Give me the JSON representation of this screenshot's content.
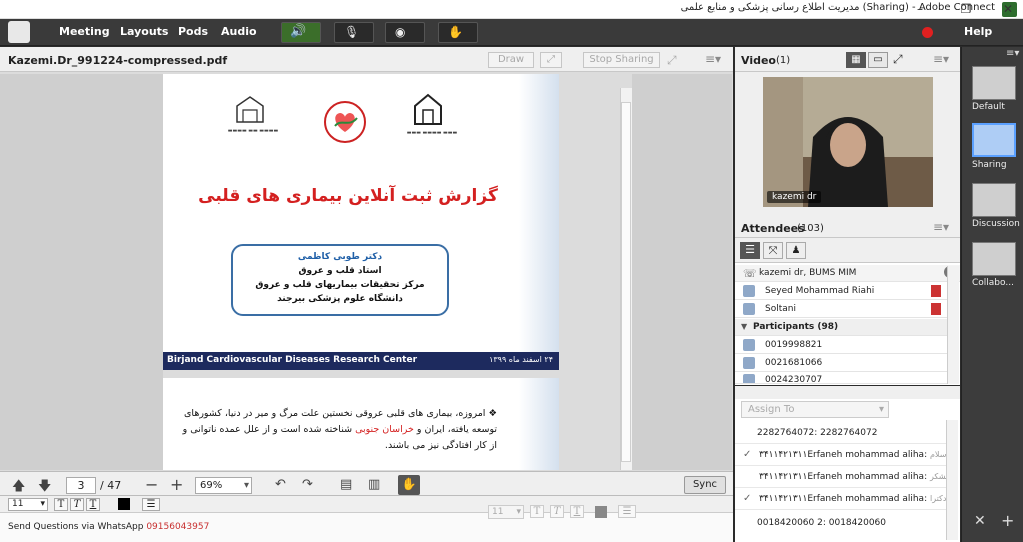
{
  "window": {
    "title": "مدیریت اطلاع رسانی پزشکی و منابع علمی (Sharing) - Adobe Connect"
  },
  "menubar": {
    "items": [
      "Meeting",
      "Layouts",
      "Pods",
      "Audio"
    ],
    "help": "Help"
  },
  "share_pod": {
    "filename": "Kazemi.Dr_991224-compressed.pdf",
    "draw_label": "Draw",
    "stop_sharing_label": "Stop Sharing",
    "page_current": "3",
    "page_total": "/ 47",
    "zoom": "69%",
    "sync_label": "Sync"
  },
  "slide": {
    "title": "گزارش ثبت آنلاین بیماری های قلبی",
    "presenter": "دکتر طوبی کاظمی",
    "line1": "استاد قلب و عروق",
    "line2": "مرکز تحقیقات بیماریهای قلب و عروق",
    "line3": "دانشگاه علوم پزشکی بیرجند",
    "banner_left": "Birjand Cardiovascular Diseases Research Center",
    "banner_right": "۲۴ اسفند ماه ۱۳۹۹",
    "body_line1": "امروزه، بیماری های قلبی عروقی نخستین علت مرگ و میر در دنیا، کشورهای",
    "body_line2a": "توسعه یافته، ایران و ",
    "body_line2b": "خراسان جنوبی",
    "body_line2c": " شناخته شده است و از علل عمده ناتوانی و",
    "body_line3": "از کار افتادگی نیز می باشند."
  },
  "chat_pod": {
    "font_size": "11",
    "message_prefix": "Send Questions via WhatsApp ",
    "message_phone": "09156043957",
    "font_size2": "11"
  },
  "video_pod": {
    "title": "Video",
    "count": "(1)",
    "name_tag": "kazemi dr"
  },
  "attendees": {
    "title": "Attendees",
    "count": "(103)",
    "host": "kazemi dr, BUMS MIM",
    "presenters": [
      "Seyed Mohammad Riahi",
      "Soltani"
    ],
    "participants_label": "Participants (98)",
    "participants": [
      "0019998821",
      "0021681066",
      "0024230707"
    ]
  },
  "qa": {
    "assign_to": "Assign To",
    "rows": [
      {
        "check": false,
        "text": "2282764072: 2282764072",
        "farsi": ""
      },
      {
        "check": true,
        "text": "۳۴۱۱۴۲۱۳۱۱Erfaneh mohammad aliha: ",
        "farsi": "سلام"
      },
      {
        "check": false,
        "text": "۳۴۱۱۴۲۱۳۱۱Erfaneh mohammad aliha: ",
        "farsi": "بلشکر"
      },
      {
        "check": true,
        "text": "۳۴۱۱۴۲۱۳۱۱Erfaneh mohammad aliha: ",
        "farsi": "دکترا"
      },
      {
        "check": false,
        "text": "0018420060 2: 0018420060",
        "farsi": ""
      }
    ]
  },
  "layouts": {
    "items": [
      "Default",
      "Sharing",
      "Discussion",
      "Collabo..."
    ]
  }
}
